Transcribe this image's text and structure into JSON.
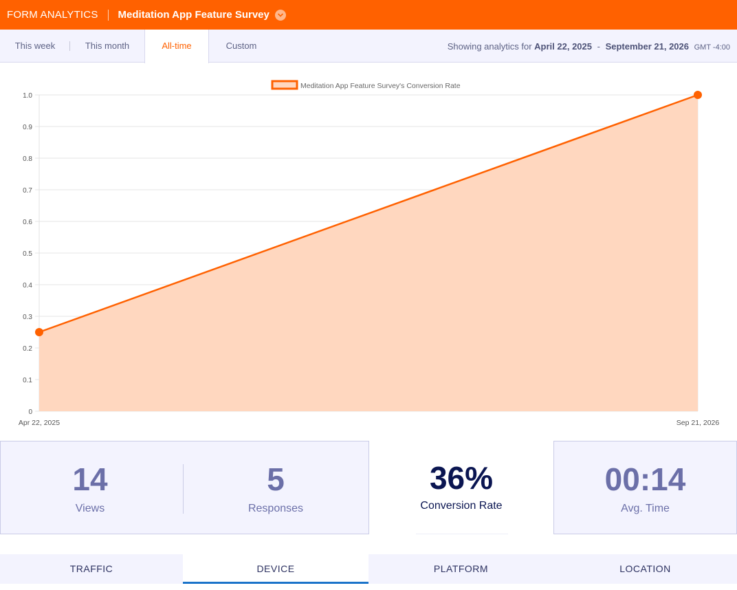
{
  "header": {
    "brand": "FORM ANALYTICS",
    "form_title": "Meditation App Feature Survey",
    "dropdown_icon": "chevron-down-icon"
  },
  "tabs": [
    {
      "label": "This week"
    },
    {
      "label": "This month"
    },
    {
      "label": "All-time",
      "active": true
    },
    {
      "label": "Custom"
    }
  ],
  "range": {
    "prefix": "Showing analytics for",
    "start": "April 22, 2025",
    "dash": "-",
    "end": "September 21, 2026",
    "timezone": "GMT -4:00"
  },
  "chart_data": {
    "type": "area",
    "x": [
      "Apr 22, 2025",
      "Sep 21, 2026"
    ],
    "series": [
      {
        "name": "Meditation App Feature Survey's Conversion Rate",
        "values": [
          0.25,
          1.0
        ]
      }
    ],
    "ylim": [
      0,
      1.0
    ],
    "yticks": [
      "0",
      "0.1",
      "0.2",
      "0.3",
      "0.4",
      "0.5",
      "0.6",
      "0.7",
      "0.8",
      "0.9",
      "1.0"
    ],
    "xlabel": "",
    "ylabel": "",
    "legend": "top-center",
    "grid": true,
    "colors": {
      "line": "#ff6100",
      "fill": "#ffd7bf"
    }
  },
  "stats": [
    {
      "value": "14",
      "label": "Views"
    },
    {
      "value": "5",
      "label": "Responses"
    },
    {
      "value": "36%",
      "label": "Conversion Rate",
      "highlight": true
    },
    {
      "value": "00:14",
      "label": "Avg. Time"
    }
  ],
  "bottom_tabs": [
    {
      "label": "TRAFFIC"
    },
    {
      "label": "DEVICE",
      "active": true
    },
    {
      "label": "PLATFORM"
    },
    {
      "label": "LOCATION"
    }
  ]
}
